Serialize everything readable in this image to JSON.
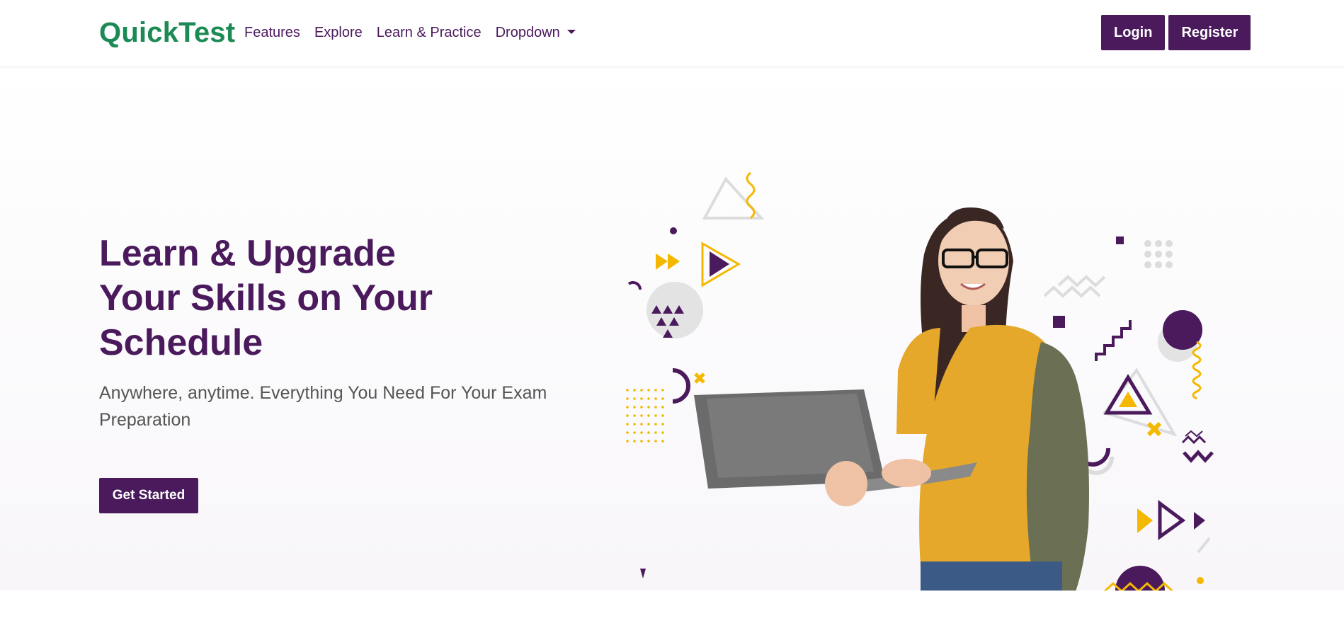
{
  "brand": {
    "name": "QuickTest",
    "color": "#1c8a54"
  },
  "nav": {
    "links": [
      {
        "label": "Features"
      },
      {
        "label": "Explore"
      },
      {
        "label": "Learn & Practice"
      },
      {
        "label": "Dropdown",
        "icon": "caret-down-icon"
      }
    ],
    "login_label": "Login",
    "register_label": "Register"
  },
  "hero": {
    "title_line1": "Learn & Upgrade",
    "title_line2": "Your Skills on Your",
    "title_line3": "Schedule",
    "subtitle": "Anywhere, anytime. Everything You Need For Your Exam Preparation",
    "cta_label": "Get Started",
    "image": "student-with-laptop-illustration"
  },
  "colors": {
    "primary": "#4a1a5c",
    "accent": "#f5b800",
    "grey_shape": "#d9d9d9"
  }
}
